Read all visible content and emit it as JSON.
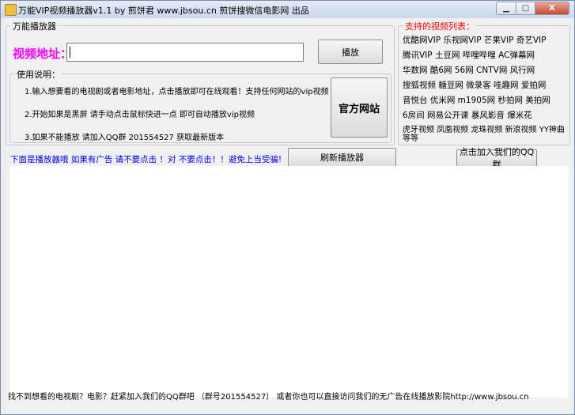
{
  "window": {
    "title": "万能VIP视频播放器v1.1 by 煎饼君  www.jbsou.cn 煎饼搜微信电影网 出品",
    "min_label": "▁",
    "max_label": "□",
    "close_label": "X"
  },
  "player_group": {
    "title": "万能播放器",
    "url_label": "视频地址：",
    "url_value": "",
    "play_button": "播放"
  },
  "instructions": {
    "title": "使用说明：",
    "items": [
      "1.输入想要看的电视剧或者电影地址，点击播放即可在线观看！支持任何网站的vip视频",
      "2.开始如果是黑屏 请手动点击鼠标快进一点 即可自动播放vip视频",
      "3.如果不能播放 请加入QQ群 201554527 获取最新版本"
    ],
    "official_button": "官方网站"
  },
  "sites": {
    "title": "支持的视频列表：",
    "rows": [
      "优酷网VIP 乐视网VIP 芒果VIP 奇艺VIP",
      "腾讯VIP 土豆网 哔哩哔哩 AC弹幕网",
      "华数网 酷6网 56网 CNTV网 风行网",
      "搜狐视频 糖豆网 微录客 哇趣网 爱拍网",
      "音悦台 优米网 m1905网 秒拍网 美拍网",
      "6房间 网易公开课 暴风影音 爆米花",
      "虎牙视频 凤凰视频 龙珠视频 新浪视频 YY神曲",
      "等等"
    ]
  },
  "toolbar": {
    "notice": "下面是播放器哦 如果有广告 请不要点击 ！对 不要点击！！避免上当受骗!",
    "refresh_button": "刷新播放器",
    "join_qq_button": "点击加入我们的QQ群"
  },
  "footer": {
    "text": "找不到想看的电视剧？电影？赶紧加入我们的QQ群吧 （群号201554527）  或者你也可以直接访问我们的无广告在线播放影院http://www.jbsou.cn"
  },
  "colors": {
    "url_label": "#ff00ff",
    "sites_title": "#ff0000",
    "notice": "#0000ff"
  }
}
